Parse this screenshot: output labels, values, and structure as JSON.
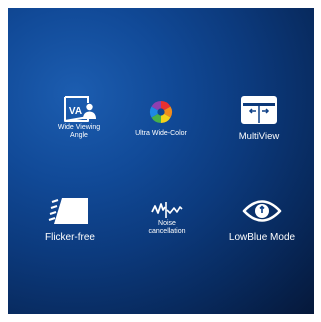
{
  "colors": {
    "panel_top_left": "#1c5db0",
    "panel_bottom_right": "#05183a",
    "text": "#ffffff"
  },
  "features": [
    {
      "label_line1": "Wide Viewing",
      "label_line2": "Angle",
      "icon_text": "VA",
      "icon": "wide-viewing-angle-icon"
    },
    {
      "label": "Ultra Wide-Color",
      "icon": "color-wheel-icon"
    },
    {
      "label": "MultiView",
      "icon": "multiview-icon"
    },
    {
      "label": "Flicker-free",
      "icon": "flicker-free-icon"
    },
    {
      "label_line1": "Noise",
      "label_line2": "cancellation",
      "icon": "noise-cancellation-icon"
    },
    {
      "label": "LowBlue Mode",
      "icon": "eye-icon"
    }
  ]
}
